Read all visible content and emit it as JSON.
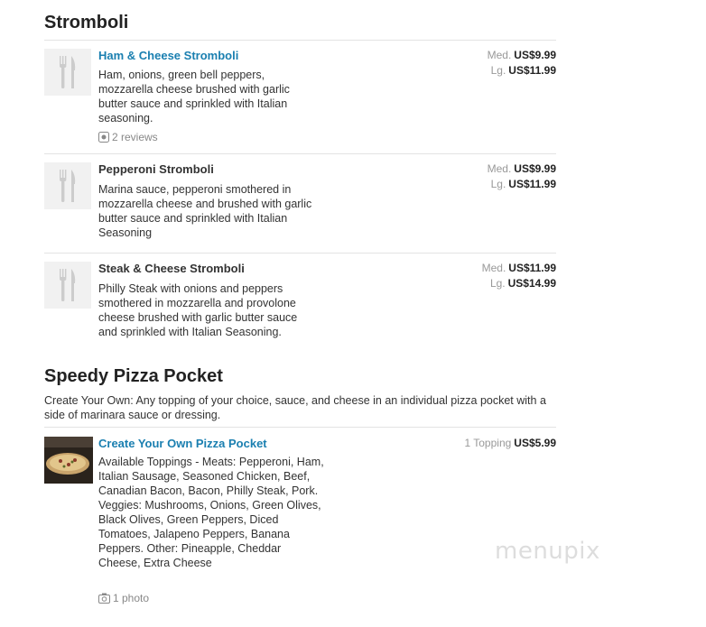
{
  "sections": [
    {
      "title": "Stromboli",
      "items": [
        {
          "name": "Ham & Cheese Stromboli",
          "description": "Ham, onions, green bell peppers, mozzarella cheese brushed with garlic butter sauce and sprinkled with Italian seasoning.",
          "reviews": "2 reviews",
          "prices": [
            {
              "size": "Med.",
              "price": "US$9.99"
            },
            {
              "size": "Lg.",
              "price": "US$11.99"
            }
          ]
        },
        {
          "name": "Pepperoni Stromboli",
          "description": "Marina sauce, pepperoni smothered in mozzarella cheese and brushed with garlic butter sauce and sprinkled with Italian Seasoning",
          "prices": [
            {
              "size": "Med.",
              "price": "US$9.99"
            },
            {
              "size": "Lg.",
              "price": "US$11.99"
            }
          ]
        },
        {
          "name": "Steak & Cheese Stromboli",
          "description": "Philly Steak with onions and peppers smothered in mozzarella and provolone cheese brushed with garlic butter sauce and sprinkled with Italian Seasoning.",
          "prices": [
            {
              "size": "Med.",
              "price": "US$11.99"
            },
            {
              "size": "Lg.",
              "price": "US$14.99"
            }
          ]
        }
      ]
    },
    {
      "title": "Speedy Pizza Pocket",
      "description": "Create Your Own: Any topping of your choice, sauce, and cheese in an individual pizza pocket with a side of marinara sauce or dressing.",
      "items": [
        {
          "name": "Create Your Own Pizza Pocket",
          "description": "Available Toppings - Meats: Pepperoni, Ham, Italian Sausage, Seasoned Chicken, Beef, Canadian Bacon, Bacon, Philly Steak, Pork. Veggies: Mushrooms, Onions, Green Olives, Black Olives, Green Peppers, Diced Tomatoes, Jalapeno Peppers, Banana Peppers. Other: Pineapple, Cheddar Cheese, Extra Cheese",
          "photos": "1 photo",
          "prices": [
            {
              "size": "1 Topping",
              "price": "US$5.99"
            }
          ]
        }
      ]
    }
  ],
  "watermark": "menupix",
  "icons": {
    "placeholder": "fork-knife-icon",
    "reviews": "review-icon",
    "photos": "camera-icon"
  },
  "colors": {
    "link": "#1a7fb0",
    "rule": "#e3e3e3",
    "muted": "#999999"
  }
}
